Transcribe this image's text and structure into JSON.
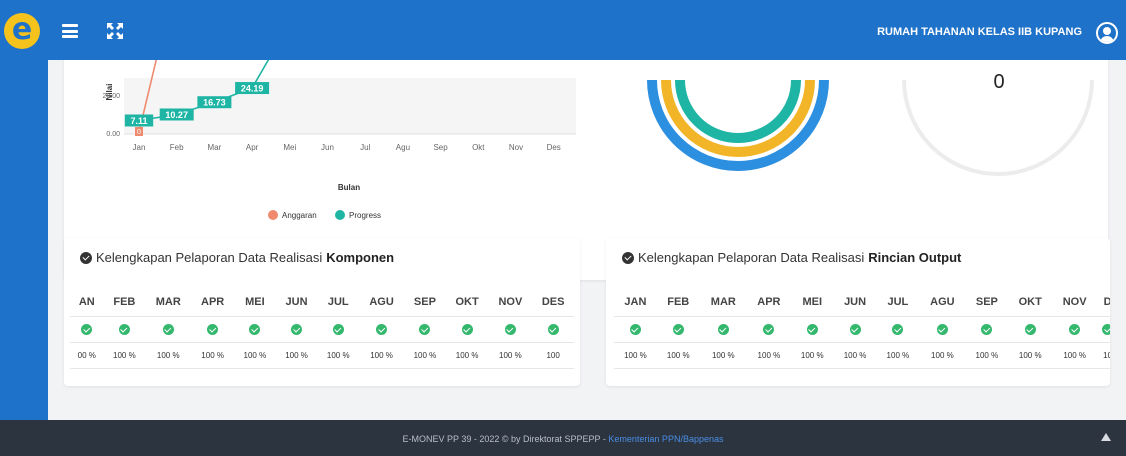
{
  "header": {
    "logo_letter": "e",
    "org_name": "RUMAH TAHANAN KELAS IIB KUPANG"
  },
  "chart": {
    "ylabel": "Nilai",
    "xlabel": "Bulan",
    "yticks": [
      "20.00",
      "0.00"
    ],
    "legend": [
      {
        "label": "Anggaran",
        "color": "#ef8a6f"
      },
      {
        "label": "Progress",
        "color": "#1fb5a5"
      }
    ]
  },
  "chart_data": {
    "type": "line",
    "categories": [
      "Jan",
      "Feb",
      "Mar",
      "Apr",
      "Mei",
      "Jun",
      "Jul",
      "Agu",
      "Sep",
      "Okt",
      "Nov",
      "Des"
    ],
    "series": [
      {
        "name": "Anggaran",
        "data_labels": [
          "0"
        ]
      },
      {
        "name": "Progress",
        "values": [
          7.11,
          10.27,
          16.73,
          24.19
        ],
        "data_labels": [
          "7.11",
          "10.27",
          "16.73",
          "24.19"
        ]
      }
    ],
    "xlabel": "Bulan",
    "ylabel": "Nilai",
    "yticks": [
      "20.00",
      "0.00"
    ],
    "legend": "bottom",
    "grid": false
  },
  "gauge_right": {
    "value": "0"
  },
  "komponen": {
    "title_prefix": "Kelengkapan Pelaporan Data Realisasi",
    "title_bold": "Komponen",
    "months": [
      "AN",
      "FEB",
      "MAR",
      "APR",
      "MEI",
      "JUN",
      "JUL",
      "AGU",
      "SEP",
      "OKT",
      "NOV",
      "DES"
    ],
    "percents": [
      "00 %",
      "100 %",
      "100 %",
      "100 %",
      "100 %",
      "100 %",
      "100 %",
      "100 %",
      "100 %",
      "100 %",
      "100 %",
      "100"
    ]
  },
  "rincian": {
    "title_prefix": "Kelengkapan Pelaporan Data Realisasi",
    "title_bold": "Rincian Output",
    "months": [
      "JAN",
      "FEB",
      "MAR",
      "APR",
      "MEI",
      "JUN",
      "JUL",
      "AGU",
      "SEP",
      "OKT",
      "NOV",
      "D"
    ],
    "percents": [
      "100 %",
      "100 %",
      "100 %",
      "100 %",
      "100 %",
      "100 %",
      "100 %",
      "100 %",
      "100 %",
      "100 %",
      "100 %",
      "10"
    ]
  },
  "footer": {
    "text": "E-MONEV PP 39 - 2022 © by Direktorat SPPEPP -",
    "link": "Kementerian PPN/Bappenas"
  },
  "colors": {
    "primary": "#1f72c9",
    "success": "#34b86e",
    "progress": "#1fb5a5",
    "anggaran": "#ef8a6f",
    "footer": "#2c3440"
  }
}
